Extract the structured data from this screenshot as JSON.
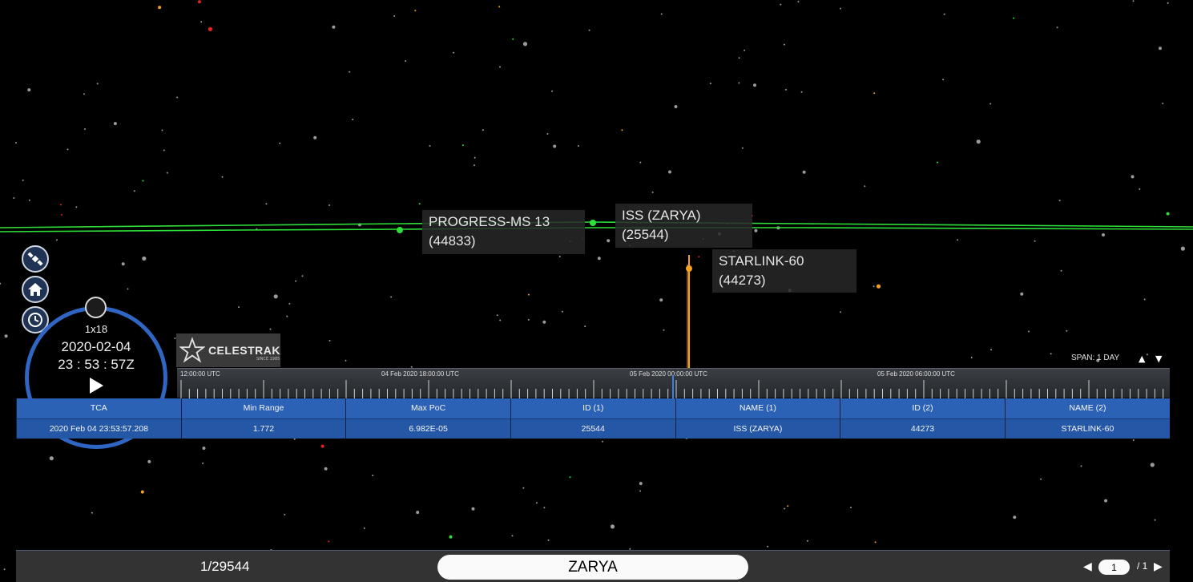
{
  "colors": {
    "accent": "#2f66c4",
    "orbit_green": "#2ee03a",
    "starlink_orange": "#f4a020",
    "table_header": "#2b62b6",
    "table_row": "#2457a6"
  },
  "labels": {
    "progress": {
      "name": "PROGRESS-MS 13",
      "id": "(44833)"
    },
    "iss": {
      "name": "ISS (ZARYA)",
      "id": "(25544)"
    },
    "starlink": {
      "name": "STARLINK-60",
      "id": "(44273)"
    }
  },
  "toolbar": {
    "satellite_icon": "satellite-icon",
    "home_icon": "home-icon",
    "clock_icon": "clock-icon"
  },
  "clock": {
    "speed": "1x18",
    "date": "2020-02-04",
    "time": "23 : 53 : 57Z",
    "play_icon": "play-icon"
  },
  "logo": {
    "text": "CELESTRAK",
    "since": "SINCE 1985"
  },
  "timeline": {
    "span_label": "SPAN: 1 DAY",
    "ticks": [
      "12:00:00 UTC",
      "04 Feb 2020 18:00:00 UTC",
      "05 Feb 2020 00:00:00 UTC",
      "05 Feb 2020 06:00:00 UTC"
    ]
  },
  "conjunction_table": {
    "headers": [
      "TCA",
      "Min Range",
      "Max PoC",
      "ID (1)",
      "NAME (1)",
      "ID (2)",
      "NAME (2)"
    ],
    "rows": [
      [
        "2020 Feb 04 23:53:57.208",
        "1.772",
        "6.982E-05",
        "25544",
        "ISS (ZARYA)",
        "44273",
        "STARLINK-60"
      ]
    ]
  },
  "bottom_bar": {
    "count": "1/29544",
    "search_value": "ZARYA",
    "page_current": "1",
    "page_total": "/ 1"
  }
}
